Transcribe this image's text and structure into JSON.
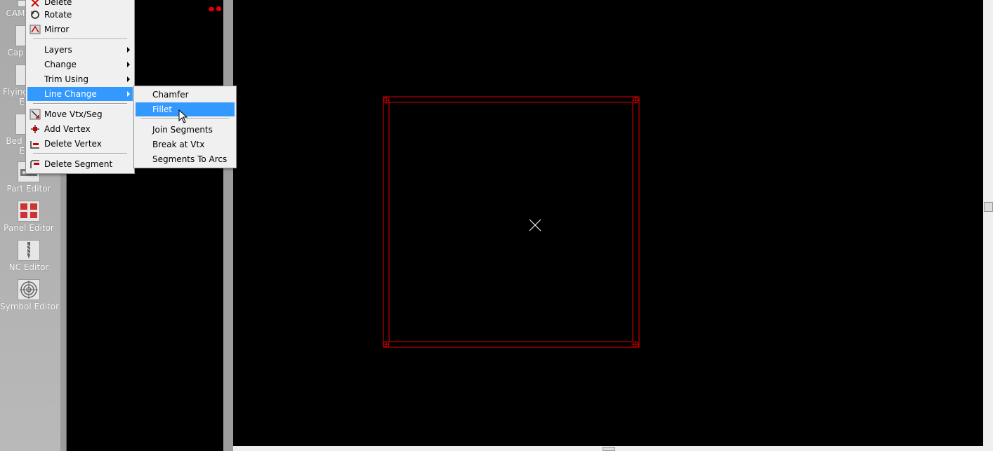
{
  "tools": [
    {
      "label": "CAM",
      "icon": "cam-icon"
    },
    {
      "label": "Cap",
      "icon": "cap-icon"
    },
    {
      "label": "Flying",
      "label2": "Ed",
      "icon": "flying-probe-icon"
    },
    {
      "label": "Bed",
      "label2": "Ed",
      "icon": "bed-of-nails-icon"
    },
    {
      "label": "Part Editor",
      "icon": "part-editor-icon"
    },
    {
      "label": "Panel Editor",
      "icon": "panel-editor-icon"
    },
    {
      "label": "NC Editor",
      "icon": "nc-editor-icon"
    },
    {
      "label": "Symbol Editor",
      "icon": "symbol-editor-icon"
    }
  ],
  "context_menu": {
    "items": [
      {
        "label": "Delete",
        "icon": "delete-icon"
      },
      {
        "label": "Rotate",
        "icon": "rotate-icon"
      },
      {
        "label": "Mirror",
        "icon": "mirror-icon"
      },
      {
        "label": "Layers"
      },
      {
        "label": "Change"
      },
      {
        "label": "Trim Using"
      },
      {
        "label": "Line Change"
      },
      {
        "label": "Move Vtx/Seg",
        "icon": "move-vertex-icon"
      },
      {
        "label": "Add Vertex",
        "icon": "add-vertex-icon"
      },
      {
        "label": "Delete Vertex",
        "icon": "delete-vertex-icon"
      },
      {
        "label": "Delete Segment",
        "icon": "delete-segment-icon"
      }
    ]
  },
  "submenu": {
    "items": [
      {
        "label": "Chamfer"
      },
      {
        "label": "Fillet"
      },
      {
        "label": "Join Segments"
      },
      {
        "label": "Break at Vtx"
      },
      {
        "label": "Segments To Arcs"
      }
    ]
  },
  "colors": {
    "outline": "#e00000",
    "highlight": "#3399ff",
    "canvas": "#000000"
  }
}
